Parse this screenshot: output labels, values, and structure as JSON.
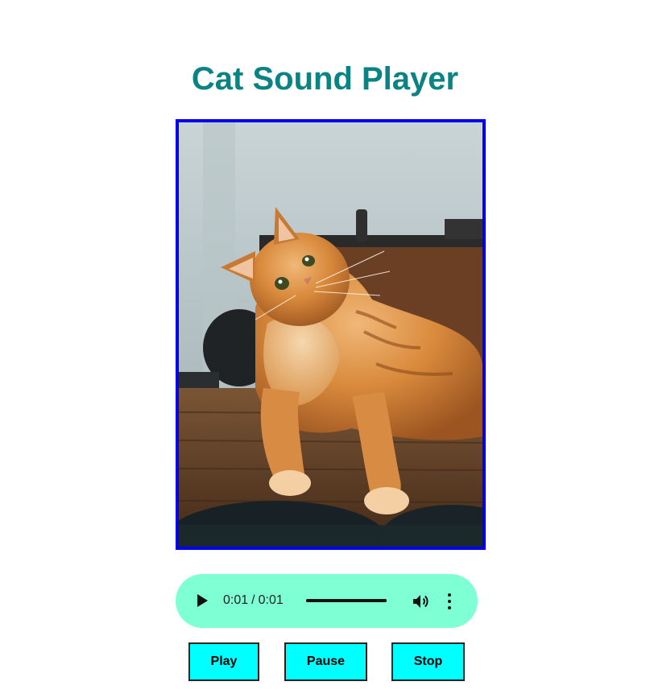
{
  "page": {
    "title": "Cat Sound Player"
  },
  "image": {
    "subject": "orange-tabby-cat-photo",
    "border_color": "#0000ee"
  },
  "audio": {
    "current_time": "0:01",
    "duration": "0:01",
    "progress_fraction": 1.0,
    "background_color": "#7fffd4"
  },
  "controls": {
    "play_label": "Play",
    "pause_label": "Pause",
    "stop_label": "Stop",
    "button_color": "#00ffff"
  },
  "icons": {
    "play": "play-icon",
    "volume": "volume-icon",
    "menu": "more-options-icon"
  },
  "colors": {
    "title": "#0b8383"
  }
}
